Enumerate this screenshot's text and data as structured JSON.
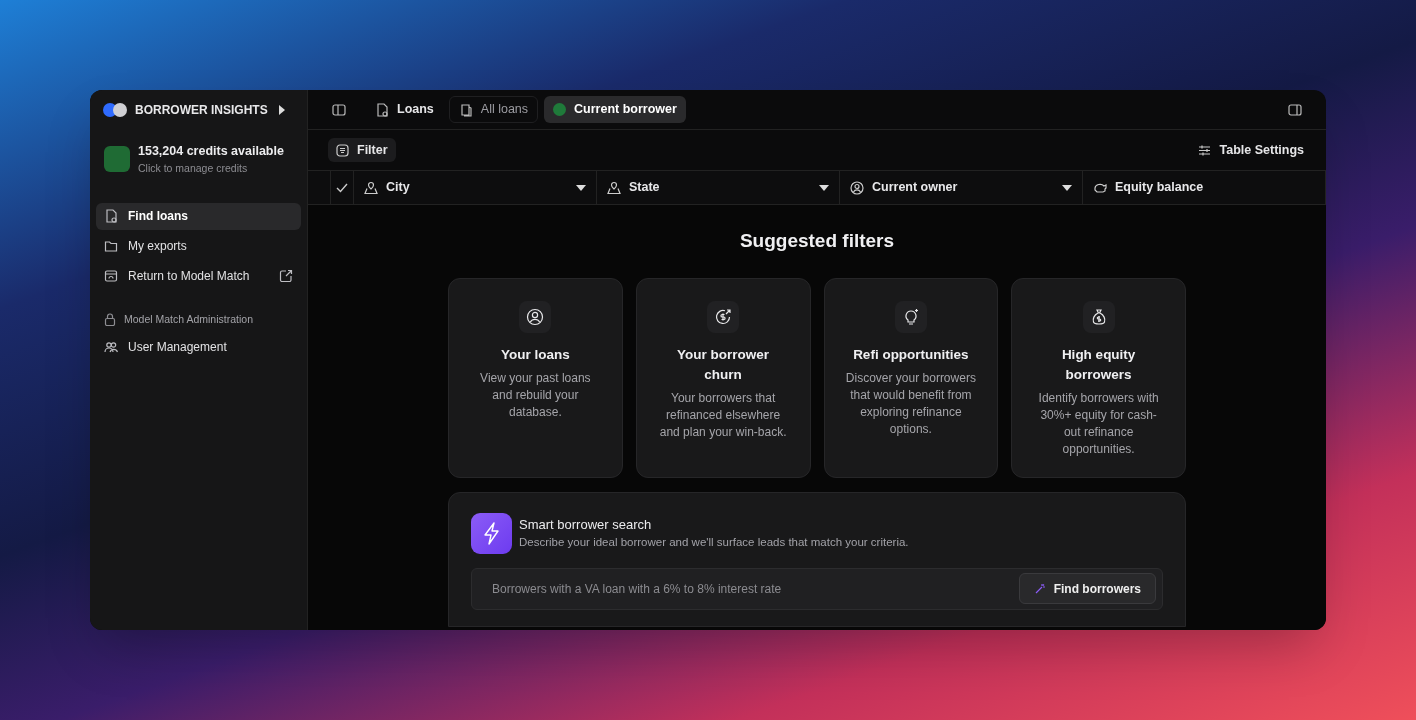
{
  "sidebar": {
    "brand": "BORROWER INSIGHTS",
    "credits": {
      "title": "153,204 credits available",
      "subtitle": "Click to manage credits"
    },
    "nav_items": [
      {
        "label": "Find loans",
        "selected": true,
        "kind": "internal"
      },
      {
        "label": "My exports",
        "selected": false,
        "kind": "internal"
      },
      {
        "label": "Return to Model Match",
        "selected": false,
        "kind": "external"
      }
    ],
    "section_title": "Model Match Administration",
    "admin_items": [
      {
        "label": "User Management",
        "selected": false
      }
    ]
  },
  "tabs": [
    {
      "label": "Loans",
      "selected": false
    },
    {
      "label": "All loans",
      "selected": false
    },
    {
      "label": "Current borrower",
      "selected": true
    }
  ],
  "toolbar": {
    "filter": "Filter",
    "table_settings": "Table Settings"
  },
  "columns": [
    {
      "label": "City",
      "has_menu": true
    },
    {
      "label": "State",
      "has_menu": true
    },
    {
      "label": "Current owner",
      "has_menu": true
    },
    {
      "label": "Equity balance",
      "has_menu": false
    }
  ],
  "suggested": {
    "title": "Suggested filters",
    "cards": [
      {
        "title": "Your loans",
        "description": "View your past loans and rebuild your database."
      },
      {
        "title": "Your borrower churn",
        "description": "Your borrowers that refinanced elsewhere and plan your win-back."
      },
      {
        "title": "Refi opportunities",
        "description": "Discover your borrowers that would benefit from exploring refinance options."
      },
      {
        "title": "High equity borrowers",
        "description": "Identify borrowers with 30%+ equity for cash-out refinance opportunities."
      }
    ]
  },
  "smart_search": {
    "title": "Smart borrower search",
    "description": "Describe your ideal borrower and we'll surface leads that match your criteria.",
    "placeholder": "Borrowers with a VA loan with a 6% to 8% interest rate",
    "button": "Find borrowers"
  }
}
